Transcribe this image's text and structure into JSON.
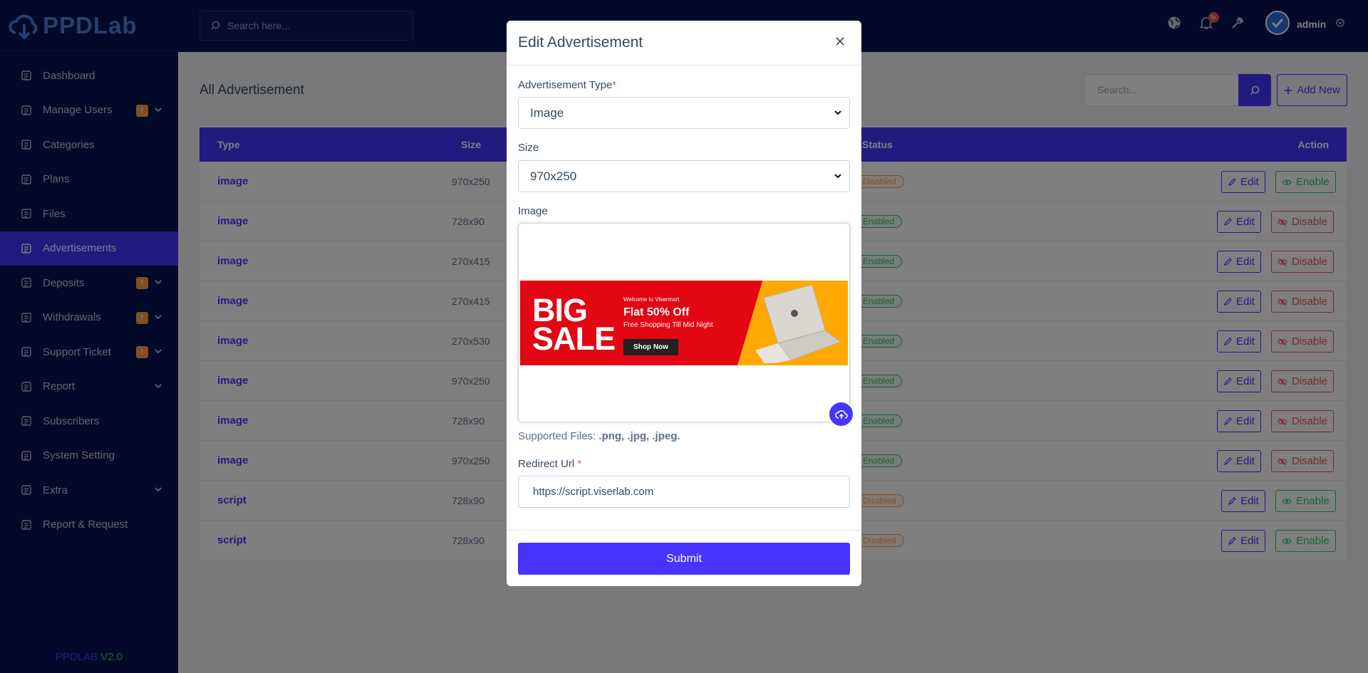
{
  "app": {
    "logo": "PPDLab",
    "version_name": "PPDLAB",
    "version_num": "V2.0"
  },
  "sidebar": {
    "items": [
      {
        "label": "Dashboard"
      },
      {
        "label": "Manage Users",
        "badge": "!"
      },
      {
        "label": "Categories"
      },
      {
        "label": "Plans"
      },
      {
        "label": "Files"
      },
      {
        "label": "Advertisements"
      },
      {
        "label": "Deposits",
        "badge": "!"
      },
      {
        "label": "Withdrawals",
        "badge": "!"
      },
      {
        "label": "Support Ticket",
        "badge": "!"
      },
      {
        "label": "Report"
      },
      {
        "label": "Subscribers"
      },
      {
        "label": "System Setting"
      },
      {
        "label": "Extra"
      },
      {
        "label": "Report & Request"
      }
    ]
  },
  "topbar": {
    "search_placeholder": "Search here...",
    "notif_count": "9+",
    "user": "admin"
  },
  "page": {
    "title": "All Advertisement",
    "search_placeholder": "Search...",
    "add_new": "Add New",
    "columns": {
      "type": "Type",
      "size": "Size",
      "status": "Status",
      "action": "Action"
    },
    "rows": [
      {
        "type": "image",
        "size": "970x250",
        "status": "Disabled",
        "edit": "Edit",
        "toggle": "Enable"
      },
      {
        "type": "image",
        "size": "728x90",
        "status": "Enabled",
        "edit": "Edit",
        "toggle": "Disable"
      },
      {
        "type": "image",
        "size": "270x415",
        "status": "Enabled",
        "edit": "Edit",
        "toggle": "Disable"
      },
      {
        "type": "image",
        "size": "270x415",
        "status": "Enabled",
        "edit": "Edit",
        "toggle": "Disable"
      },
      {
        "type": "image",
        "size": "270x530",
        "status": "Enabled",
        "edit": "Edit",
        "toggle": "Disable"
      },
      {
        "type": "image",
        "size": "970x250",
        "status": "Enabled",
        "edit": "Edit",
        "toggle": "Disable"
      },
      {
        "type": "image",
        "size": "728x90",
        "status": "Enabled",
        "edit": "Edit",
        "toggle": "Disable"
      },
      {
        "type": "image",
        "size": "970x250",
        "status": "Enabled",
        "edit": "Edit",
        "toggle": "Disable"
      },
      {
        "type": "script",
        "size": "728x90",
        "status": "Disabled",
        "edit": "Edit",
        "toggle": "Enable"
      },
      {
        "type": "script",
        "size": "728x90",
        "status": "Disabled",
        "edit": "Edit",
        "toggle": "Enable"
      }
    ]
  },
  "modal": {
    "title": "Edit Advertisement",
    "type_label": "Advertisement Type",
    "type_value": "Image",
    "size_label": "Size",
    "size_value": "970x250",
    "image_label": "Image",
    "banner": {
      "big": "BIG",
      "sale": "SALE",
      "welcome": "Welcome to Visermart",
      "offer": "Flat 50% Off",
      "sub": "Free Shopping Till Mid Night",
      "cta": "Shop Now"
    },
    "supported_prefix": "Supported Files:",
    "supported_types": ".png, .jpg, .jpeg.",
    "url_label": "Redirect Url",
    "url_value": "https://script.viserlab.com",
    "submit": "Submit"
  }
}
